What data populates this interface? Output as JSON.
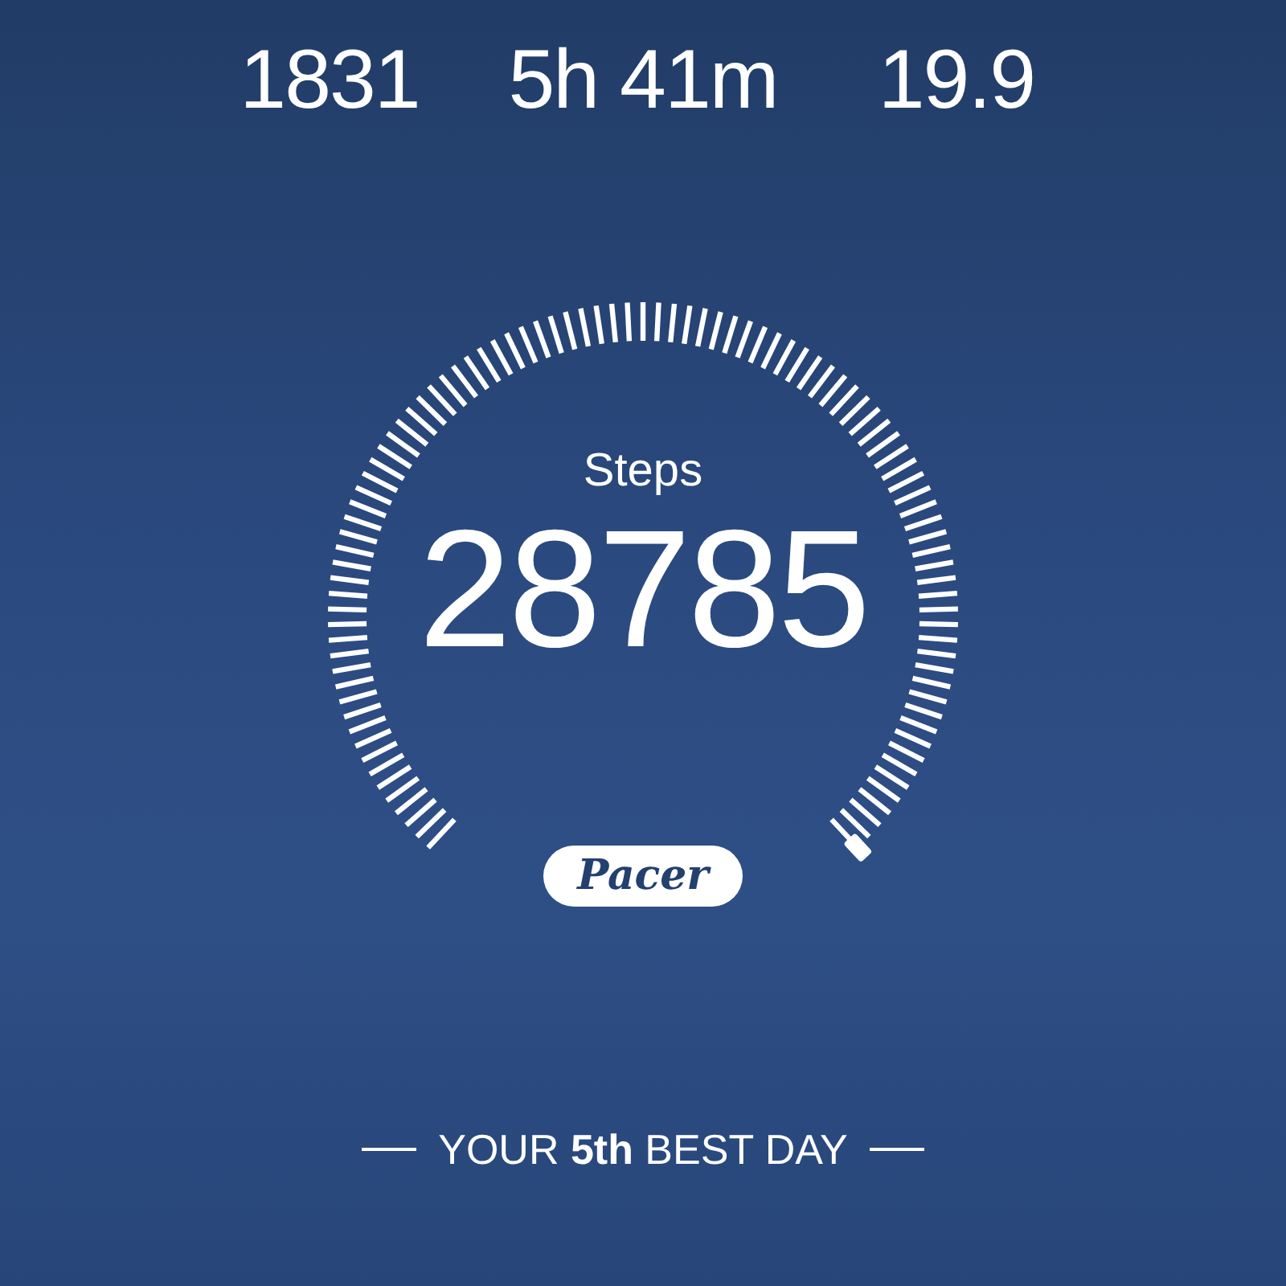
{
  "stats": [
    {
      "value": "1831"
    },
    {
      "value": "5h 41m"
    },
    {
      "value": "19.9"
    }
  ],
  "gauge": {
    "label": "Steps",
    "value": "28785"
  },
  "logo": "Pacer",
  "footer": "YOUR **5th** BEST DAY"
}
